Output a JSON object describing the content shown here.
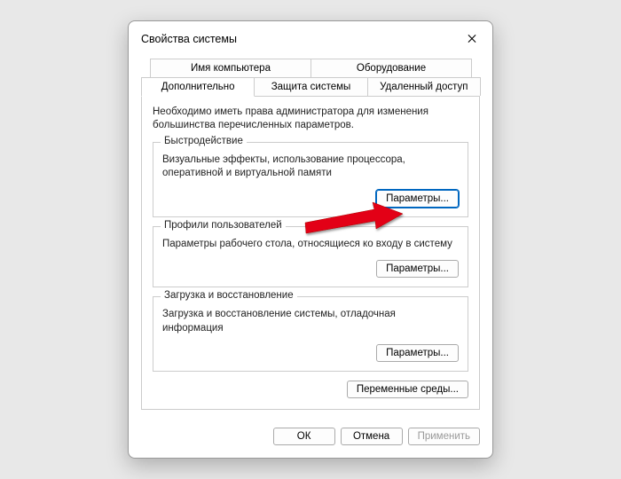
{
  "title": "Свойства системы",
  "tabs": {
    "row1": [
      "Имя компьютера",
      "Оборудование"
    ],
    "row2": [
      "Дополнительно",
      "Защита системы",
      "Удаленный доступ"
    ],
    "active": "Дополнительно"
  },
  "admin_note": "Необходимо иметь права администратора для изменения большинства перечисленных параметров.",
  "groups": {
    "performance": {
      "legend": "Быстродействие",
      "desc": "Визуальные эффекты, использование процессора, оперативной и виртуальной памяти",
      "button": "Параметры..."
    },
    "profiles": {
      "legend": "Профили пользователей",
      "desc": "Параметры рабочего стола, относящиеся ко входу в систему",
      "button": "Параметры..."
    },
    "startup": {
      "legend": "Загрузка и восстановление",
      "desc": "Загрузка и восстановление системы, отладочная информация",
      "button": "Параметры..."
    }
  },
  "env_button": "Переменные среды...",
  "footer": {
    "ok": "ОК",
    "cancel": "Отмена",
    "apply": "Применить"
  }
}
